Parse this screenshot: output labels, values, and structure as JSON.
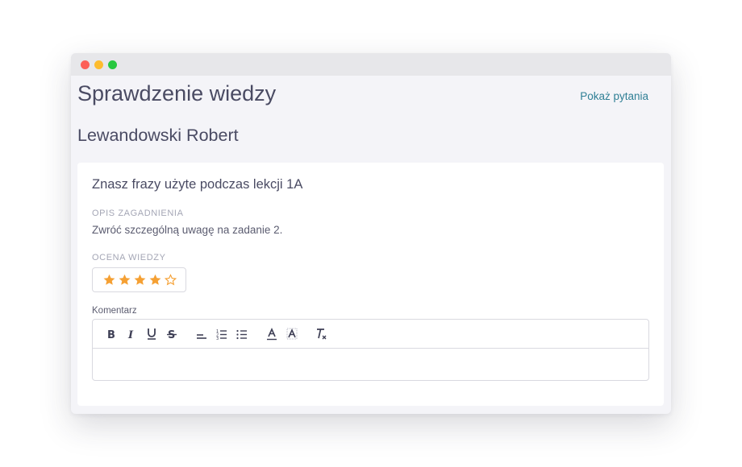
{
  "window": {
    "traffic_lights": [
      {
        "name": "close",
        "color": "#fc5f57"
      },
      {
        "name": "minimize",
        "color": "#fdbc2e"
      },
      {
        "name": "maximize",
        "color": "#28c840"
      }
    ]
  },
  "header": {
    "title": "Sprawdzenie wiedzy",
    "show_questions_link": "Pokaż pytania"
  },
  "student": {
    "name": "Lewandowski Robert"
  },
  "card": {
    "title": "Znasz frazy użyte podczas lekcji 1A",
    "description_label": "OPIS ZAGADNIENIA",
    "description_text": "Zwróć szczególną uwagę na zadanie 2.",
    "grade_label": "OCENA WIEDZY",
    "rating": {
      "value": 4,
      "max": 5,
      "color": "#f5a033"
    },
    "comment_label": "Komentarz",
    "comment_value": ""
  },
  "toolbar": {
    "buttons": [
      {
        "name": "bold",
        "icon": "bold-icon"
      },
      {
        "name": "italic",
        "icon": "italic-icon"
      },
      {
        "name": "underline",
        "icon": "underline-icon"
      },
      {
        "name": "strikethrough",
        "icon": "strikethrough-icon"
      },
      {
        "name": "align",
        "icon": "align-left-icon"
      },
      {
        "name": "ordered-list",
        "icon": "ordered-list-icon"
      },
      {
        "name": "bullet-list",
        "icon": "bullet-list-icon"
      },
      {
        "name": "text-color",
        "icon": "text-color-icon"
      },
      {
        "name": "background-color",
        "icon": "background-color-icon"
      },
      {
        "name": "clear-format",
        "icon": "clear-format-icon"
      }
    ]
  },
  "colors": {
    "accent_link": "#2f7f95",
    "heading": "#4a4b63",
    "page_background": "#f4f4f8"
  }
}
